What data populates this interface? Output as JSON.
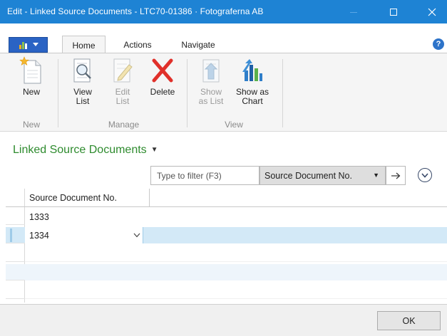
{
  "window": {
    "title": "Edit - Linked Source Documents - LTC70-01386 · Fotograferna AB",
    "titlebar_color": "#1e83d4"
  },
  "ribbon": {
    "tabs": [
      {
        "label": "Home",
        "active": true
      },
      {
        "label": "Actions",
        "active": false
      },
      {
        "label": "Navigate",
        "active": false
      }
    ],
    "groups": {
      "new": {
        "label": "New",
        "buttons": [
          {
            "label": "New",
            "icon": "new-document-icon",
            "enabled": true
          }
        ]
      },
      "manage": {
        "label": "Manage",
        "buttons": [
          {
            "label_line1": "View",
            "label_line2": "List",
            "icon": "view-list-icon",
            "enabled": true
          },
          {
            "label_line1": "Edit",
            "label_line2": "List",
            "icon": "edit-list-icon",
            "enabled": false
          },
          {
            "label_line1": "Delete",
            "label_line2": "",
            "icon": "delete-icon",
            "enabled": true
          }
        ]
      },
      "view": {
        "label": "View",
        "buttons": [
          {
            "label_line1": "Show",
            "label_line2": "as List",
            "icon": "show-as-list-icon",
            "enabled": false
          },
          {
            "label_line1": "Show as",
            "label_line2": "Chart",
            "icon": "show-as-chart-icon",
            "enabled": true
          }
        ]
      }
    }
  },
  "page": {
    "title": "Linked Source Documents",
    "title_color": "#2e8b2e"
  },
  "filter": {
    "placeholder": "Type to filter (F3)",
    "field": "Source Document No."
  },
  "grid": {
    "column_header": "Source Document No.",
    "rows": [
      {
        "value": "1333",
        "selected": false
      },
      {
        "value": "1334",
        "selected": true
      },
      {
        "value": "",
        "selected": false
      },
      {
        "value": "",
        "selected": false
      },
      {
        "value": "",
        "selected": false
      }
    ]
  },
  "footer": {
    "ok_label": "OK"
  }
}
